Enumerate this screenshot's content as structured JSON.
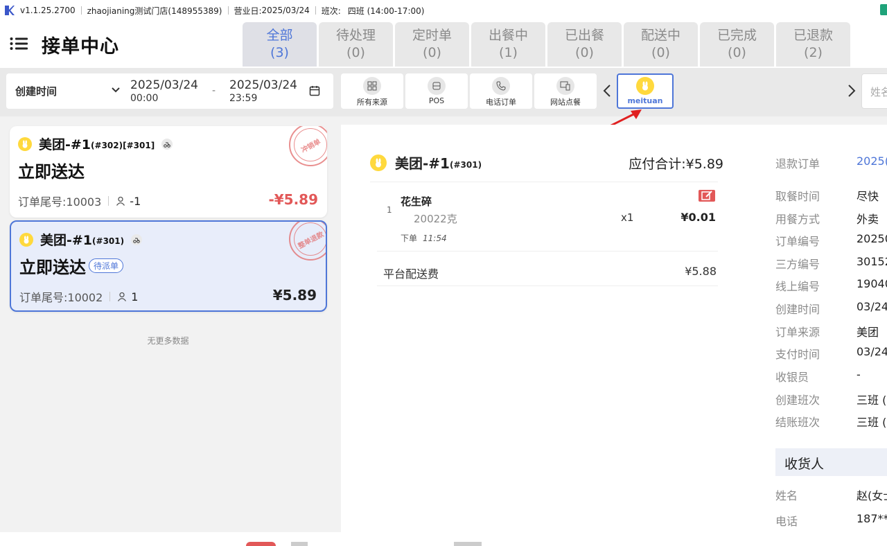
{
  "titlebar": {
    "version": "v1.1.25.2700",
    "store": "zhaojianing测试门店(148955389)",
    "business_day_label": "营业日:",
    "business_day": "2025/03/24",
    "shift_label": "班次:",
    "shift": "四班 (14:00-17:00)"
  },
  "header": {
    "title": "接单中心",
    "tabs": [
      {
        "label": "全部",
        "count": "(3)"
      },
      {
        "label": "待处理",
        "count": "(0)"
      },
      {
        "label": "定时单",
        "count": "(0)"
      },
      {
        "label": "出餐中",
        "count": "(1)"
      },
      {
        "label": "已出餐",
        "count": "(0)"
      },
      {
        "label": "配送中",
        "count": "(0)"
      },
      {
        "label": "已完成",
        "count": "(0)"
      },
      {
        "label": "已退款",
        "count": "(2)"
      }
    ]
  },
  "filter": {
    "date_type": "创建时间",
    "start_date": "2025/03/24",
    "start_time": "00:00",
    "dash": "-",
    "end_date": "2025/03/24",
    "end_time": "23:59",
    "sources": [
      "所有来源",
      "POS",
      "电话订单",
      "网站点餐",
      "meituan"
    ],
    "name_placeholder": "姓名"
  },
  "orders": [
    {
      "platform": "美团-#1",
      "sub": "(#302)[#301]",
      "delivery": "立即送达",
      "tail": "订单尾号:10003",
      "people": "-1",
      "price": "-¥5.89",
      "stamp": "冲销单"
    },
    {
      "platform": "美团-#1",
      "sub": "(#301)",
      "delivery": "立即送达",
      "pill": "待派单",
      "tail": "订单尾号:10002",
      "people": "1",
      "price": "¥5.89",
      "stamp": "整单退款"
    }
  ],
  "no_more": "无更多数据",
  "detail": {
    "platform": "美团-#1",
    "sub": "(#301)",
    "total": "应付合计:¥5.89",
    "item": {
      "idx": "1",
      "name": "花生碎",
      "spec": "20022克",
      "qty": "x1",
      "price": "¥0.01",
      "order_label": "下单",
      "order_time": "11:54"
    },
    "fee_label": "平台配送费",
    "fee_value": "¥5.88"
  },
  "info": {
    "rows": [
      {
        "k": "退款订单",
        "v": "2025("
      },
      {
        "k": "取餐时间",
        "v": "尽快"
      },
      {
        "k": "用餐方式",
        "v": "外卖"
      },
      {
        "k": "订单编号",
        "v": "20250"
      },
      {
        "k": "三方编号",
        "v": "30152"
      },
      {
        "k": "线上编号",
        "v": "19040"
      },
      {
        "k": "创建时间",
        "v": "03/24"
      },
      {
        "k": "订单来源",
        "v": "美团"
      },
      {
        "k": "支付时间",
        "v": "03/24"
      },
      {
        "k": "收银员",
        "v": "-"
      },
      {
        "k": "创建班次",
        "v": "三班 ("
      },
      {
        "k": "结账班次",
        "v": "三班 ("
      }
    ],
    "section": "收货人",
    "rows2": [
      {
        "k": "姓名",
        "v": "赵(女士"
      },
      {
        "k": "电话",
        "v": "187**"
      }
    ]
  },
  "colors": {
    "accent": "#4e76d8",
    "danger": "#e25858",
    "meituan": "#ffd93d"
  }
}
